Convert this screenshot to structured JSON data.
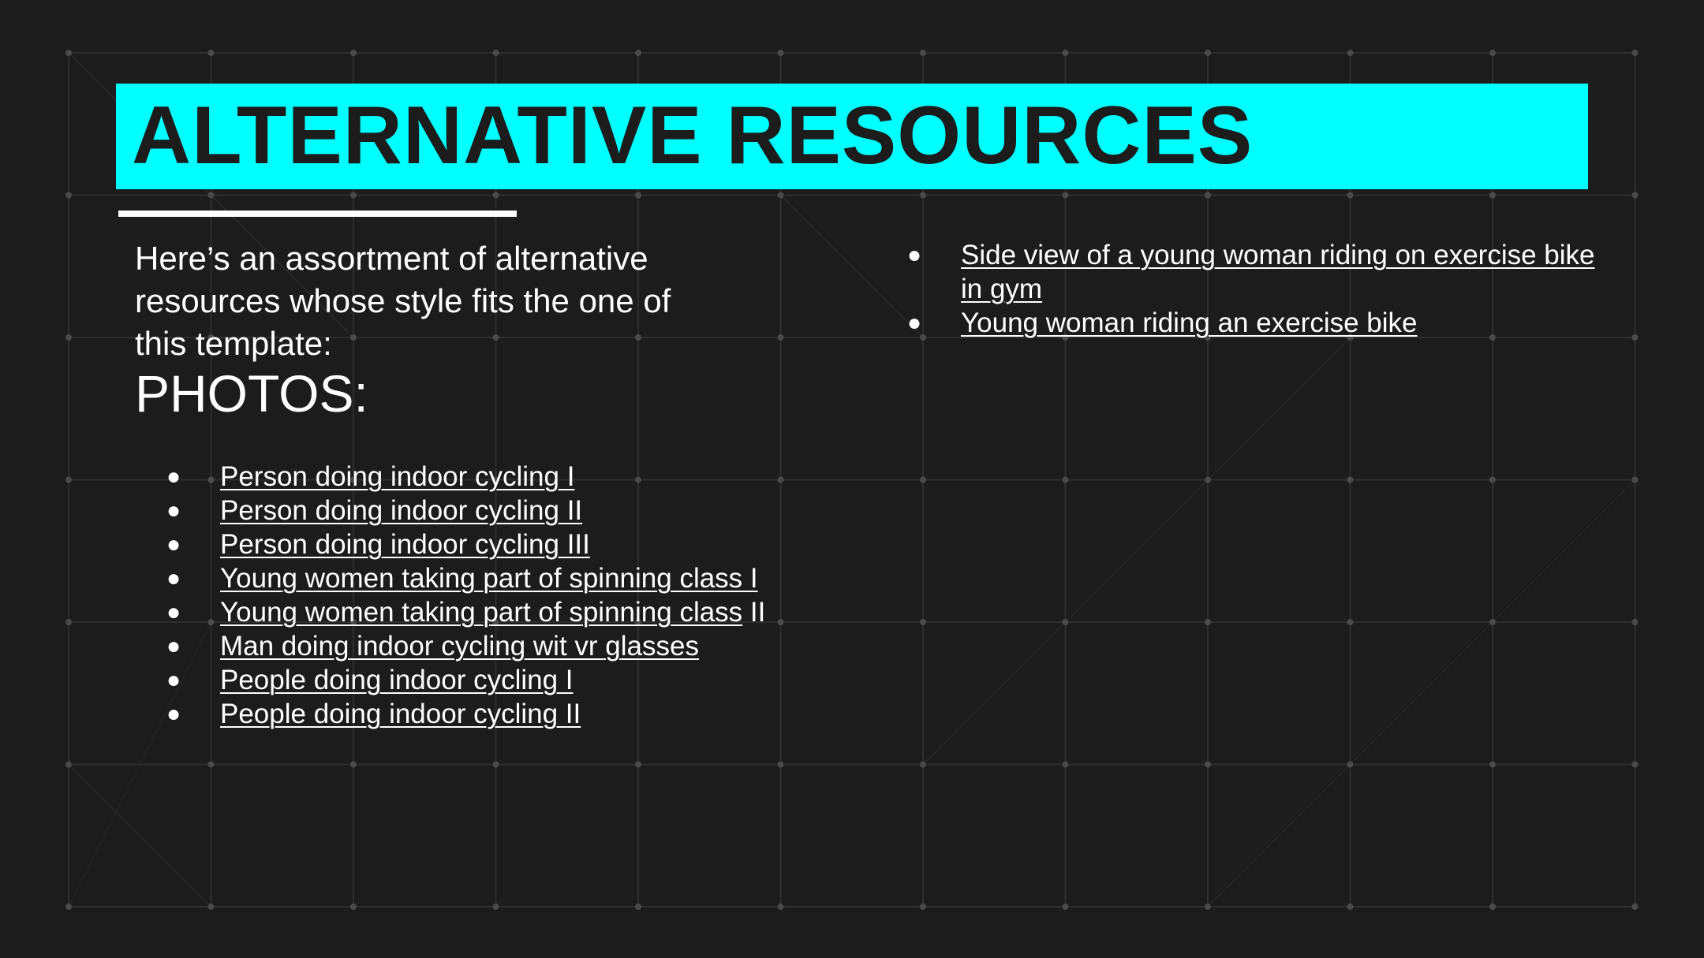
{
  "slide": {
    "title": "ALTERNATIVE RESOURCES",
    "intro": "Here’s an assortment of alternative resources whose style fits the one of this template:",
    "section_heading": "PHOTOS:",
    "colors": {
      "background": "#1c1c1c",
      "accent": "#00ffff",
      "text": "#ffffff",
      "grid": "#2e2e2e"
    },
    "links_left": [
      {
        "text": "Person doing indoor cycling I",
        "suffix": ""
      },
      {
        "text": "Person doing indoor cycling II",
        "suffix": ""
      },
      {
        "text": "Person doing indoor cycling III",
        "suffix": ""
      },
      {
        "text": "Young women taking part of spinning class I",
        "suffix": ""
      },
      {
        "text": "Young women taking part of spinning class",
        "suffix": " II"
      },
      {
        "text": "Man doing indoor cycling wit vr glasses",
        "suffix": ""
      },
      {
        "text": "People doing indoor cycling I",
        "suffix": ""
      },
      {
        "text": "People doing indoor cycling II",
        "suffix": ""
      }
    ],
    "links_right": [
      {
        "text": "Side view of a young woman riding on exercise bike in gym",
        "suffix": ""
      },
      {
        "text": "Young woman riding an exercise bike",
        "suffix": ""
      }
    ]
  }
}
